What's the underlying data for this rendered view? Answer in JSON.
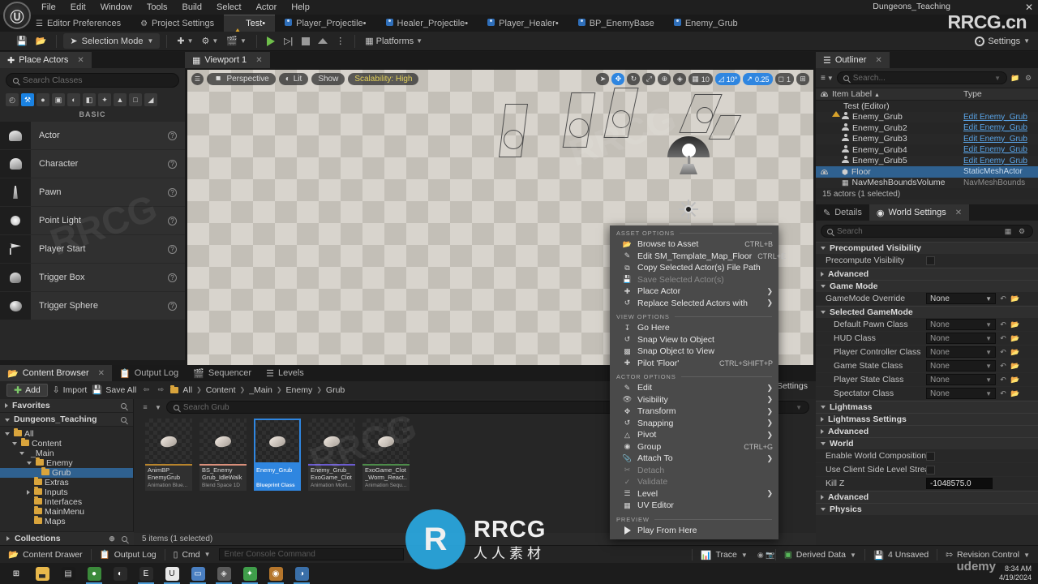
{
  "titlebar": {
    "menu": [
      "File",
      "Edit",
      "Window",
      "Tools",
      "Build",
      "Select",
      "Actor",
      "Help"
    ],
    "project_name": "Dungeons_Teaching",
    "close_label": "✕",
    "watermark": "RRCG.cn"
  },
  "tabs": [
    {
      "label": "Editor Preferences",
      "icon": "sliders-icon",
      "active": false
    },
    {
      "label": "Project Settings",
      "icon": "wrench-icon",
      "active": false
    },
    {
      "label": "Test•",
      "icon": "level-icon",
      "active": true
    },
    {
      "label": "Player_Projectile•",
      "icon": "blueprint-icon",
      "active": false
    },
    {
      "label": "Healer_Projectile•",
      "icon": "blueprint-icon",
      "active": false
    },
    {
      "label": "Player_Healer•",
      "icon": "blueprint-icon",
      "active": false
    },
    {
      "label": "BP_EnemyBase",
      "icon": "blueprint-icon",
      "active": false
    },
    {
      "label": "Enemy_Grub",
      "icon": "blueprint-icon",
      "active": false
    }
  ],
  "toolbar": {
    "save_tip": "Save",
    "browse_tip": "Browse",
    "selection_mode": "Selection Mode",
    "platforms": "Platforms",
    "settings": "Settings"
  },
  "place_actors": {
    "tab_title": "Place Actors",
    "close": "✕",
    "search_placeholder": "Search Classes",
    "category_label": "BASIC",
    "categories": [
      {
        "name": "recent-icon",
        "glyph": "◴",
        "active": false
      },
      {
        "name": "basic-icon",
        "glyph": "⚒",
        "active": true
      },
      {
        "name": "lights-icon",
        "glyph": "●",
        "active": false
      },
      {
        "name": "cinematic-icon",
        "glyph": "▣",
        "active": false
      },
      {
        "name": "visual-effects-icon",
        "glyph": "◐",
        "active": false
      },
      {
        "name": "geometry-icon",
        "glyph": "◧",
        "active": false
      },
      {
        "name": "volumes-icon",
        "glyph": "✦",
        "active": false
      },
      {
        "name": "all-classes-icon",
        "glyph": "▲",
        "active": false
      },
      {
        "name": "shapes-icon",
        "glyph": "□",
        "active": false
      },
      {
        "name": "misc-icon",
        "glyph": "◢",
        "active": false
      }
    ],
    "items": [
      {
        "label": "Actor",
        "icon": "actor-icon"
      },
      {
        "label": "Character",
        "icon": "character-icon"
      },
      {
        "label": "Pawn",
        "icon": "pawn-icon"
      },
      {
        "label": "Point Light",
        "icon": "point-light-icon"
      },
      {
        "label": "Player Start",
        "icon": "player-start-icon"
      },
      {
        "label": "Trigger Box",
        "icon": "trigger-box-icon"
      },
      {
        "label": "Trigger Sphere",
        "icon": "trigger-sphere-icon"
      }
    ]
  },
  "viewport": {
    "tab_title": "Viewport 1",
    "close": "✕",
    "view_mode": "Perspective",
    "lit_mode": "Lit",
    "show_menu": "Show",
    "scalability": "Scalability: High",
    "transform_tools": [
      {
        "name": "select-tool",
        "glyph": "➤",
        "active": false
      },
      {
        "name": "move-tool",
        "glyph": "✥",
        "active": true
      },
      {
        "name": "rotate-tool",
        "glyph": "↻",
        "active": false
      },
      {
        "name": "scale-tool",
        "glyph": "⤢",
        "active": false
      }
    ],
    "world_coord": "⊕",
    "surface_snap": "◈",
    "grid_snap_value": "10",
    "angle_snap_value": "10°",
    "scale_snap_value": "0.25",
    "camera_speed": "1",
    "maximize": "⊞"
  },
  "outliner": {
    "tab_title": "Outliner",
    "close": "✕",
    "search_placeholder": "Search...",
    "columns": {
      "item_label": "Item Label",
      "type": "Type",
      "sort_arrow": "▲"
    },
    "rows": [
      {
        "label": "Test (Editor)",
        "type": "",
        "icon": "level-icon",
        "indent": 1,
        "selected": false,
        "link": false
      },
      {
        "label": "Enemy_Grub",
        "type": "Edit Enemy_Grub",
        "icon": "pawn-icon",
        "indent": 2,
        "selected": false,
        "link": true
      },
      {
        "label": "Enemy_Grub2",
        "type": "Edit Enemy_Grub",
        "icon": "pawn-icon",
        "indent": 2,
        "selected": false,
        "link": true
      },
      {
        "label": "Enemy_Grub3",
        "type": "Edit Enemy_Grub",
        "icon": "pawn-icon",
        "indent": 2,
        "selected": false,
        "link": true
      },
      {
        "label": "Enemy_Grub4",
        "type": "Edit Enemy_Grub",
        "icon": "pawn-icon",
        "indent": 2,
        "selected": false,
        "link": true
      },
      {
        "label": "Enemy_Grub5",
        "type": "Edit Enemy_Grub",
        "icon": "pawn-icon",
        "indent": 2,
        "selected": false,
        "link": true
      },
      {
        "label": "Floor",
        "type": "StaticMeshActor",
        "icon": "mesh-icon",
        "indent": 2,
        "selected": true,
        "link": false
      },
      {
        "label": "NavMeshBoundsVolume",
        "type": "NavMeshBounds",
        "icon": "volume-icon",
        "indent": 2,
        "selected": false,
        "link": false
      }
    ],
    "footer": "15 actors (1 selected)"
  },
  "details": {
    "tabs": [
      {
        "label": "Details",
        "icon": "details-icon",
        "active": false
      },
      {
        "label": "World Settings",
        "icon": "globe-icon",
        "active": true
      }
    ],
    "close": "✕",
    "search_placeholder": "Search",
    "sections": [
      {
        "kind": "cat",
        "label": "Precomputed Visibility",
        "open": true
      },
      {
        "kind": "row",
        "label": "Precompute Visibility",
        "control": "checkbox",
        "value": "",
        "indent": 0
      },
      {
        "kind": "cat-collapsed",
        "label": "Advanced",
        "open": false
      },
      {
        "kind": "cat",
        "label": "Game Mode",
        "open": true
      },
      {
        "kind": "row",
        "label": "GameMode Override",
        "control": "combo-lit",
        "value": "None",
        "indent": 0
      },
      {
        "kind": "cat",
        "label": "Selected GameMode",
        "open": true
      },
      {
        "kind": "row",
        "label": "Default Pawn Class",
        "control": "combo",
        "value": "None",
        "indent": 1
      },
      {
        "kind": "row",
        "label": "HUD Class",
        "control": "combo",
        "value": "None",
        "indent": 1
      },
      {
        "kind": "row",
        "label": "Player Controller Class",
        "control": "combo",
        "value": "None",
        "indent": 1
      },
      {
        "kind": "row",
        "label": "Game State Class",
        "control": "combo",
        "value": "None",
        "indent": 1
      },
      {
        "kind": "row",
        "label": "Player State Class",
        "control": "combo",
        "value": "None",
        "indent": 1
      },
      {
        "kind": "row",
        "label": "Spectator Class",
        "control": "combo",
        "value": "None",
        "indent": 1
      },
      {
        "kind": "cat",
        "label": "Lightmass",
        "open": true
      },
      {
        "kind": "cat-collapsed",
        "label": "Lightmass Settings",
        "open": false
      },
      {
        "kind": "cat-collapsed",
        "label": "Advanced",
        "open": false
      },
      {
        "kind": "cat",
        "label": "World",
        "open": true
      },
      {
        "kind": "row",
        "label": "Enable World Composition",
        "control": "checkbox",
        "value": "",
        "indent": 0
      },
      {
        "kind": "row",
        "label": "Use Client Side Level Streaming...",
        "control": "checkbox",
        "value": "",
        "indent": 0
      },
      {
        "kind": "row",
        "label": "Kill Z",
        "control": "number",
        "value": "-1048575.0",
        "indent": 0
      },
      {
        "kind": "cat-collapsed",
        "label": "Advanced",
        "open": false
      },
      {
        "kind": "cat",
        "label": "Physics",
        "open": true
      }
    ]
  },
  "content_browser": {
    "tabs": [
      {
        "label": "Content Browser",
        "icon": "folder-icon",
        "active": true
      },
      {
        "label": "Output Log",
        "icon": "log-icon",
        "active": false
      },
      {
        "label": "Sequencer",
        "icon": "clapper-icon",
        "active": false
      },
      {
        "label": "Levels",
        "icon": "levels-icon",
        "active": false
      }
    ],
    "close": "✕",
    "add_label": "Add",
    "import_label": "Import",
    "save_all_label": "Save All",
    "breadcrumb": [
      "All",
      "Content",
      "_Main",
      "Enemy",
      "Grub"
    ],
    "favorites_label": "Favorites",
    "project_label": "Dungeons_Teaching",
    "tree": [
      {
        "label": "All",
        "indent": 0,
        "icon": "folder-icon",
        "selected": false,
        "expanded": true
      },
      {
        "label": "Content",
        "indent": 1,
        "icon": "folder-icon",
        "selected": false,
        "expanded": true
      },
      {
        "label": "_Main",
        "indent": 2,
        "icon": "bluedot-icon",
        "selected": false,
        "expanded": true
      },
      {
        "label": "Enemy",
        "indent": 3,
        "icon": "folder-icon",
        "selected": false,
        "expanded": true
      },
      {
        "label": "Grub",
        "indent": 4,
        "icon": "folder-icon",
        "selected": true,
        "expanded": false
      },
      {
        "label": "Extras",
        "indent": 3,
        "icon": "folder-icon",
        "selected": false,
        "expanded": false
      },
      {
        "label": "Inputs",
        "indent": 3,
        "icon": "folder-icon",
        "selected": false,
        "expanded": false
      },
      {
        "label": "Interfaces",
        "indent": 3,
        "icon": "folder-icon",
        "selected": false,
        "expanded": false
      },
      {
        "label": "MainMenu",
        "indent": 3,
        "icon": "folder-icon",
        "selected": false,
        "expanded": false
      },
      {
        "label": "Maps",
        "indent": 3,
        "icon": "folder-icon",
        "selected": false,
        "expanded": false
      }
    ],
    "collections_label": "Collections",
    "search_placeholder": "Search Grub",
    "settings_label": "Settings",
    "assets": [
      {
        "name": "AnimBP_\nEnemyGrub",
        "type": "Animation Blue...",
        "bar_color": "#b8842c",
        "selected": false
      },
      {
        "name": "BS_Enemy\nGrub_IdleWalk",
        "type": "Blend Space 1D",
        "bar_color": "#d98f7a",
        "selected": false
      },
      {
        "name": "Enemy_Grub",
        "type": "Blueprint Class",
        "bar_color": "#2f86e0",
        "selected": true
      },
      {
        "name": "Enemy_Grub_\nExoGame_Clot",
        "type": "Animation Mont...",
        "bar_color": "#6b5bd0",
        "selected": false
      },
      {
        "name": "ExoGame_Clot\n_Worm_React...",
        "type": "Animation Sequ...",
        "bar_color": "#4d8c4a",
        "selected": false
      }
    ],
    "footer": "5 items (1 selected)"
  },
  "context_menu": {
    "groups": [
      {
        "title": "ASSET OPTIONS",
        "items": [
          {
            "label": "Browse to Asset",
            "icon": "browse-icon",
            "shortcut": "CTRL+B",
            "submenu": false,
            "disabled": false
          },
          {
            "label": "Edit SM_Template_Map_Floor",
            "icon": "edit-icon",
            "shortcut": "CTRL+E",
            "submenu": false,
            "disabled": false
          },
          {
            "label": "Copy Selected Actor(s) File Path",
            "icon": "copy-icon",
            "shortcut": "",
            "submenu": false,
            "disabled": false
          },
          {
            "label": "Save Selected Actor(s)",
            "icon": "save-icon",
            "shortcut": "",
            "submenu": false,
            "disabled": true
          },
          {
            "label": "Place Actor",
            "icon": "place-actor-icon",
            "shortcut": "",
            "submenu": true,
            "disabled": false
          },
          {
            "label": "Replace Selected Actors with",
            "icon": "replace-icon",
            "shortcut": "",
            "submenu": true,
            "disabled": false
          }
        ]
      },
      {
        "title": "VIEW OPTIONS",
        "items": [
          {
            "label": "Go Here",
            "icon": "go-here-icon",
            "shortcut": "",
            "submenu": false,
            "disabled": false
          },
          {
            "label": "Snap View to Object",
            "icon": "snap-view-icon",
            "shortcut": "",
            "submenu": false,
            "disabled": false
          },
          {
            "label": "Snap Object to View",
            "icon": "snap-object-icon",
            "shortcut": "",
            "submenu": false,
            "disabled": false
          },
          {
            "label": "Pilot 'Floor'",
            "icon": "pilot-icon",
            "shortcut": "CTRL+SHIFT+P",
            "submenu": false,
            "disabled": false
          }
        ]
      },
      {
        "title": "ACTOR OPTIONS",
        "items": [
          {
            "label": "Edit",
            "icon": "pencil-icon",
            "shortcut": "",
            "submenu": true,
            "disabled": false
          },
          {
            "label": "Visibility",
            "icon": "eye-icon",
            "shortcut": "",
            "submenu": true,
            "disabled": false
          },
          {
            "label": "Transform",
            "icon": "transform-icon",
            "shortcut": "",
            "submenu": true,
            "disabled": false
          },
          {
            "label": "Snapping",
            "icon": "snapping-icon",
            "shortcut": "",
            "submenu": true,
            "disabled": false
          },
          {
            "label": "Pivot",
            "icon": "pivot-icon",
            "shortcut": "",
            "submenu": true,
            "disabled": false
          },
          {
            "label": "Group",
            "icon": "group-icon",
            "shortcut": "CTRL+G",
            "submenu": false,
            "disabled": false
          },
          {
            "label": "Attach To",
            "icon": "attach-icon",
            "shortcut": "",
            "submenu": true,
            "disabled": false
          },
          {
            "label": "Detach",
            "icon": "detach-icon",
            "shortcut": "",
            "submenu": false,
            "disabled": true
          },
          {
            "label": "Validate",
            "icon": "validate-icon",
            "shortcut": "",
            "submenu": false,
            "disabled": true
          },
          {
            "label": "Level",
            "icon": "level-icon",
            "shortcut": "",
            "submenu": true,
            "disabled": false
          },
          {
            "label": "UV Editor",
            "icon": "uv-editor-icon",
            "shortcut": "",
            "submenu": false,
            "disabled": false
          }
        ]
      },
      {
        "title": "PREVIEW",
        "items": [
          {
            "label": "Play From Here",
            "icon": "play-icon",
            "shortcut": "",
            "submenu": false,
            "disabled": false
          }
        ]
      }
    ]
  },
  "statusbar": {
    "content_drawer": "Content Drawer",
    "output_log": "Output Log",
    "cmd_label": "Cmd",
    "console_placeholder": "Enter Console Command",
    "trace": "Trace",
    "derived_data": "Derived Data",
    "unsaved": "4 Unsaved",
    "revision_control": "Revision Control"
  },
  "taskbar": {
    "apps": [
      {
        "name": "start-icon",
        "glyph": "⊞",
        "color": "#ffffff",
        "bg": "transparent",
        "running": false
      },
      {
        "name": "file-explorer-icon",
        "glyph": "▃",
        "color": "#2b2b2b",
        "bg": "#e8b84b",
        "running": false
      },
      {
        "name": "terminal-icon",
        "glyph": "▤",
        "color": "#cccccc",
        "bg": "#1a1a1a",
        "running": false
      },
      {
        "name": "chrome-icon",
        "glyph": "●",
        "color": "#ffffff",
        "bg": "#3b8a3b",
        "running": true
      },
      {
        "name": "media-icon",
        "glyph": "◐",
        "color": "#ffffff",
        "bg": "#2a2a2a",
        "running": false
      },
      {
        "name": "epic-games-icon",
        "glyph": "E",
        "color": "#ffffff",
        "bg": "#2a2a2a",
        "running": true
      },
      {
        "name": "unreal-engine-icon",
        "glyph": "U",
        "color": "#1a1a1a",
        "bg": "#e8e8e8",
        "running": true
      },
      {
        "name": "notes-icon",
        "glyph": "▭",
        "color": "#ffffff",
        "bg": "#4a7fc1",
        "running": true
      },
      {
        "name": "photoshop-icon",
        "glyph": "◈",
        "color": "#dddddd",
        "bg": "#5a5a5a",
        "running": true
      },
      {
        "name": "maya-icon",
        "glyph": "✦",
        "color": "#ffffff",
        "bg": "#3f9d4a",
        "running": true
      },
      {
        "name": "blender-icon",
        "glyph": "◉",
        "color": "#ffffff",
        "bg": "#b5762c",
        "running": true
      },
      {
        "name": "browser-icon",
        "glyph": "◑",
        "color": "#ffffff",
        "bg": "#3a6fa8",
        "running": true
      }
    ],
    "time": "8:34 AM",
    "date": "4/19/2024",
    "udemy_watermark": "udemy"
  },
  "watermark": {
    "logo_letter": "R",
    "brand": "RRCG",
    "sub": "人人素材"
  }
}
